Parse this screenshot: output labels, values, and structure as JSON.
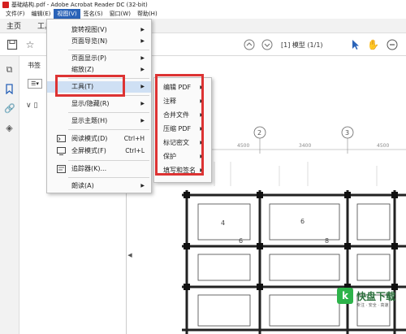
{
  "window": {
    "title": "基础结构.pdf - Adobe Acrobat Reader DC (32-bit)"
  },
  "menubar": [
    "文件(F)",
    "编辑(E)",
    "视图(V)",
    "签名(S)",
    "窗口(W)",
    "帮助(H)"
  ],
  "tabs": {
    "home": "主页",
    "tools": "工具"
  },
  "toolbar": {
    "page_info": "[1] 模型    (1/1)"
  },
  "bookmarks": {
    "title": "书签"
  },
  "view_menu": {
    "items": [
      {
        "label": "旋转视图(V)",
        "arrow": "▶"
      },
      {
        "label": "页面导览(N)",
        "arrow": "▶"
      },
      {
        "label": "页面显示(P)",
        "arrow": "▶"
      },
      {
        "label": "缩放(Z)",
        "arrow": "▶"
      },
      {
        "label": "工具(T)",
        "arrow": "▶"
      },
      {
        "label": "显示/隐藏(R)",
        "arrow": "▶"
      },
      {
        "label": "显示主题(H)",
        "arrow": "▶"
      },
      {
        "label": "阅读模式(D)",
        "shortcut": "Ctrl+H"
      },
      {
        "label": "全屏模式(F)",
        "shortcut": "Ctrl+L"
      },
      {
        "label": "追踪器(K)..."
      },
      {
        "label": "朗读(A)",
        "arrow": "▶"
      }
    ]
  },
  "tools_submenu": {
    "items": [
      "编辑 PDF",
      "注释",
      "合并文件",
      "压缩 PDF",
      "标记密文",
      "保护",
      "填写和签名"
    ]
  },
  "drawing": {
    "axis_labels": [
      "2",
      "3"
    ],
    "dimensions": [
      "4500",
      "3400",
      "4500"
    ],
    "room_numbers": [
      "4",
      "6",
      "6",
      "8"
    ]
  },
  "watermark": {
    "badge": "k",
    "name": "快盘下载",
    "tagline": "专注 · 安全 · 高速"
  },
  "colors": {
    "menu_active": "#2a63b8",
    "highlight_box": "#dd3333",
    "watermark_green": "#2db34a"
  }
}
